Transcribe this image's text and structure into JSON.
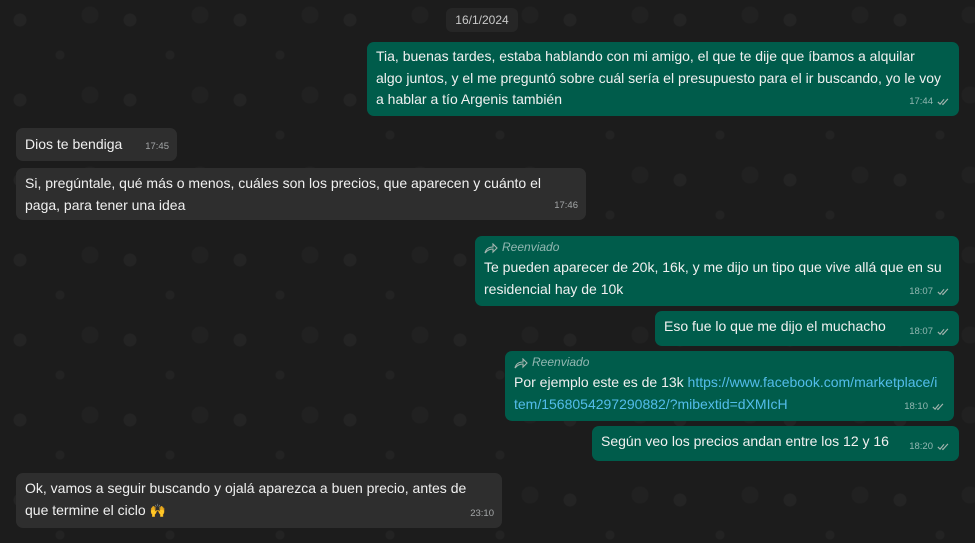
{
  "date_divider": "16/1/2024",
  "messages": [
    {
      "dir": "out",
      "text": "Tia, buenas tardes, estaba hablando con mi amigo, el que te dije que íbamos a alquilar algo juntos, y el me preguntó sobre cuál sería el presupuesto para el ir buscando, yo le voy a hablar a tío Argenis también",
      "time": "17:44"
    },
    {
      "dir": "in",
      "text": "Dios te bendiga",
      "time": "17:45"
    },
    {
      "dir": "in",
      "text": "Si, pregúntale, qué más o menos, cuáles son los precios, que aparecen y cuánto el paga, para tener una idea",
      "time": "17:46"
    },
    {
      "dir": "out",
      "forwarded": "Reenviado",
      "text": "Te pueden aparecer de 20k, 16k, y me dijo un tipo que vive allá que en su residencial hay de 10k",
      "time": "18:07"
    },
    {
      "dir": "out",
      "text": "Eso fue lo que me dijo el muchacho",
      "time": "18:07"
    },
    {
      "dir": "out",
      "forwarded": "Reenviado",
      "text": "Por ejemplo este es de 13k ",
      "link": "https://www.facebook.com/marketplace/item/1568054297290882/?mibextid=dXMIcH",
      "time": "18:10"
    },
    {
      "dir": "out",
      "text": "Según veo los precios andan entre los 12 y 16",
      "time": "18:20"
    },
    {
      "dir": "in",
      "text": "Ok, vamos a seguir buscando y ojalá aparezca a buen precio, antes de que termine el ciclo ",
      "emoji": "🙌",
      "time": "23:10"
    }
  ]
}
